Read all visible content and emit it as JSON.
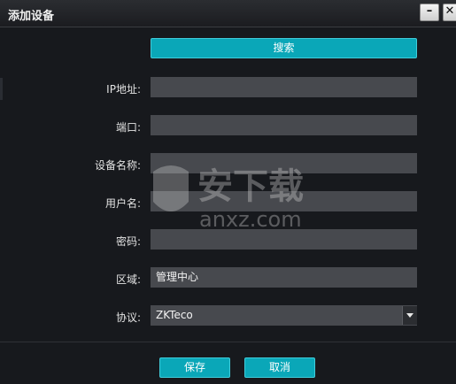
{
  "window": {
    "title": "添加设备",
    "minimize": "–",
    "close": "✕"
  },
  "search_button": "搜索",
  "fields": {
    "ip": {
      "label": "IP地址:",
      "value": ""
    },
    "port": {
      "label": "端口:",
      "value": ""
    },
    "device_name": {
      "label": "设备名称:",
      "value": ""
    },
    "username": {
      "label": "用户名:",
      "value": ""
    },
    "password": {
      "label": "密码:",
      "value": ""
    },
    "area": {
      "label": "区域:",
      "value": "管理中心"
    },
    "protocol": {
      "label": "协议:",
      "value": "ZKTeco"
    }
  },
  "footer": {
    "save": "保存",
    "cancel": "取消"
  },
  "watermark": {
    "text": "安下载",
    "sub": "anxz.com"
  },
  "colors": {
    "accent": "#0aa7b8",
    "background": "#17191d",
    "field": "#47494e"
  }
}
